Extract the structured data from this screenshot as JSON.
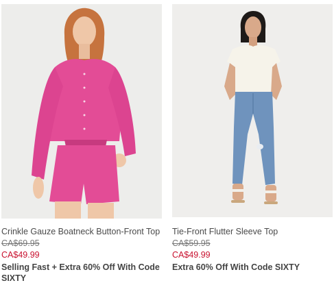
{
  "products": [
    {
      "name": "Crinkle Gauze Boatneck Button-Front Top",
      "original_price": "CA$69.95",
      "sale_price": "CA$49.99",
      "promo": "Selling Fast + Extra 60% Off With Code SIXTY",
      "image_colors": {
        "garment": "#e34c96",
        "background": "#ededeb"
      }
    },
    {
      "name": "Tie-Front Flutter Sleeve Top",
      "original_price": "CA$59.95",
      "sale_price": "CA$49.99",
      "promo": "Extra 60% Off With Code SIXTY",
      "image_colors": {
        "garment": "#f6f3ea",
        "jeans": "#6f93bd",
        "background": "#efeeec"
      }
    }
  ],
  "colors": {
    "sale": "#c8102e",
    "strike": "#777777",
    "text": "#4a4a4a"
  }
}
